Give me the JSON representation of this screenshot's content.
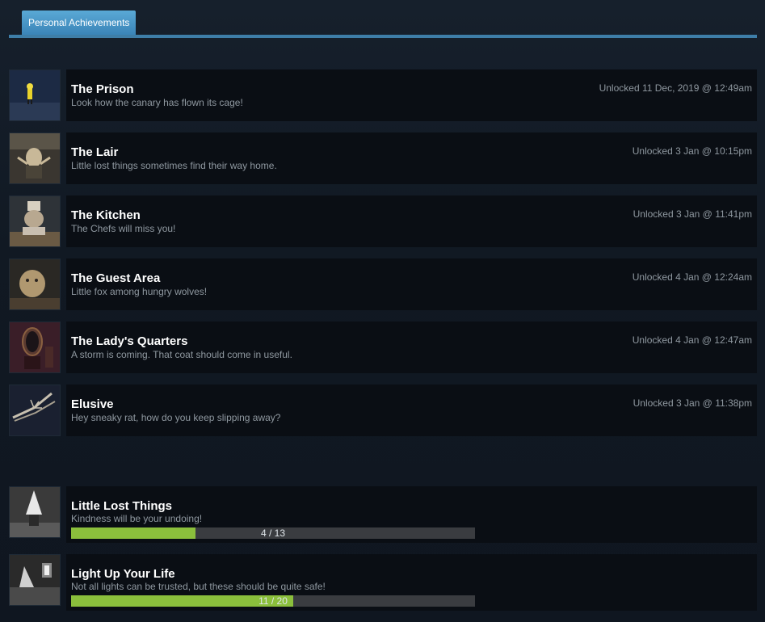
{
  "tabs": {
    "active_label": "Personal Achievements"
  },
  "colors": {
    "accent": "#3e7ea8",
    "progress_fill": "#8bbf3c",
    "progress_track": "#3a3c40"
  },
  "unlocked": [
    {
      "title": "The Prison",
      "description": "Look how the canary has flown its cage!",
      "unlocked": "Unlocked 11 Dec, 2019 @ 12:49am",
      "icon": "raincoat-girl-icon"
    },
    {
      "title": "The Lair",
      "description": "Little lost things sometimes find their way home.",
      "unlocked": "Unlocked 3 Jan @ 10:15pm",
      "icon": "janitor-icon"
    },
    {
      "title": "The Kitchen",
      "description": "The Chefs will miss you!",
      "unlocked": "Unlocked 3 Jan @ 11:41pm",
      "icon": "chef-icon"
    },
    {
      "title": "The Guest Area",
      "description": "Little fox among hungry wolves!",
      "unlocked": "Unlocked 4 Jan @ 12:24am",
      "icon": "guest-icon"
    },
    {
      "title": "The Lady's Quarters",
      "description": "A storm is coming. That coat should come in useful.",
      "unlocked": "Unlocked 4 Jan @ 12:47am",
      "icon": "mirror-icon"
    },
    {
      "title": "Elusive",
      "description": "Hey sneaky rat, how do you keep slipping away?",
      "unlocked": "Unlocked 3 Jan @ 11:38pm",
      "icon": "long-arms-icon"
    }
  ],
  "in_progress": [
    {
      "title": "Little Lost Things",
      "description": "Kindness will be your undoing!",
      "progress_text": "4 / 13",
      "progress_current": 4,
      "progress_total": 13,
      "icon": "nome-icon"
    },
    {
      "title": "Light Up Your Life",
      "description": "Not all lights can be trusted, but these should be quite safe!",
      "progress_text": "11 / 20",
      "progress_current": 11,
      "progress_total": 20,
      "icon": "lamp-icon"
    }
  ]
}
